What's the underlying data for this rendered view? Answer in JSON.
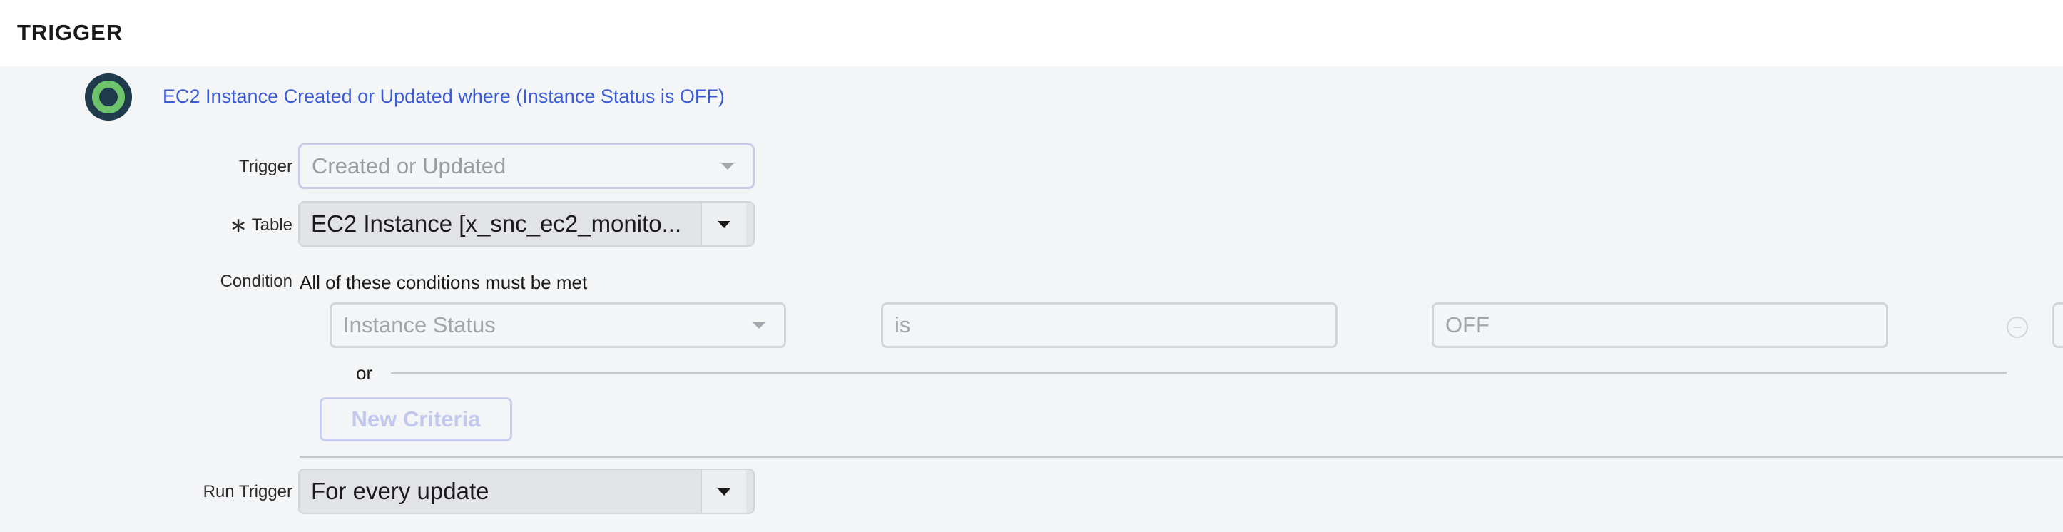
{
  "header": {
    "title": "TRIGGER"
  },
  "summary": {
    "text": "EC2 Instance Created or Updated where (Instance Status is OFF)"
  },
  "form": {
    "trigger": {
      "label": "Trigger",
      "value": "Created or Updated"
    },
    "table": {
      "required_marker": "∗",
      "label": "Table",
      "value": "EC2 Instance [x_snc_ec2_monito..."
    },
    "condition": {
      "label": "Condition",
      "description": "All of these conditions must be met",
      "rows": [
        {
          "field": "Instance Status",
          "operator": "is",
          "value": "OFF"
        }
      ],
      "or_label": "or",
      "new_criteria_label": "New Criteria"
    },
    "run_trigger": {
      "label": "Run Trigger",
      "value": "For every update"
    }
  },
  "colors": {
    "link": "#3c5bd6",
    "icon_ring": "#6cc36c",
    "icon_bg": "#1f3a4b",
    "background": "#f4f5f7"
  }
}
